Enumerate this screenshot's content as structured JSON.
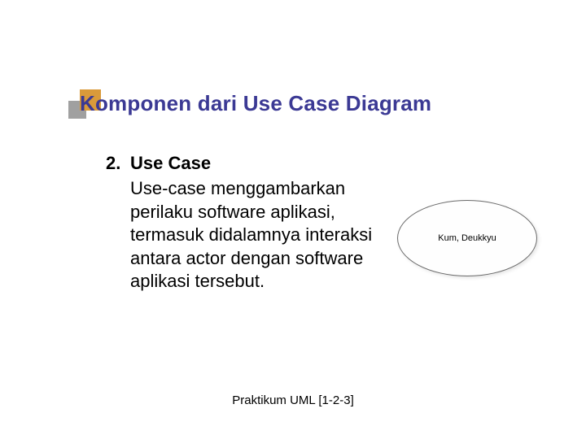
{
  "title": "Komponen dari Use Case Diagram",
  "item": {
    "number": "2.",
    "name": "Use Case",
    "description": "Use-case menggambarkan perilaku software aplikasi, termasuk didalamnya interaksi antara actor dengan software aplikasi tersebut."
  },
  "ellipse_label": "Kum, Deukkyu",
  "footer": "Praktikum UML [1-2-3]"
}
